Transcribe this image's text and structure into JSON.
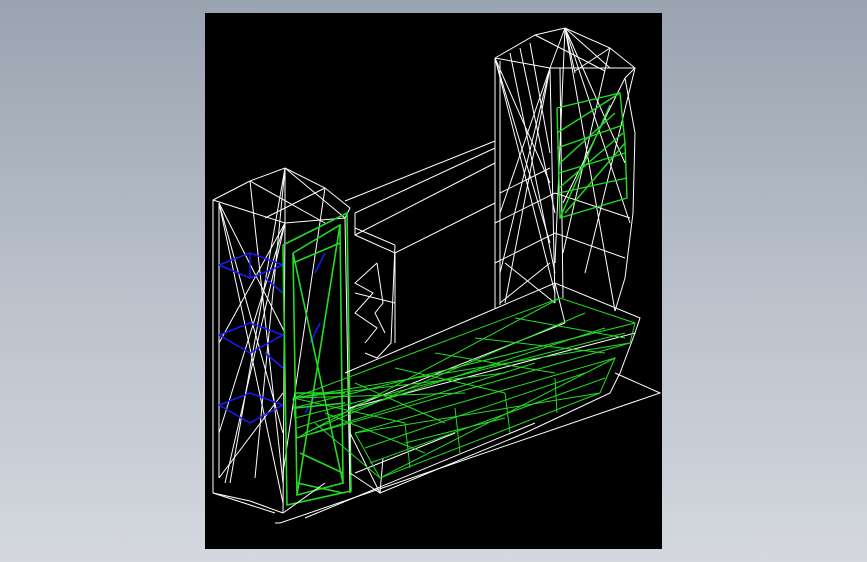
{
  "colors": {
    "background_top": "#9aa3b0",
    "background_bottom": "#d4d8de",
    "viewport_background": "#000000",
    "edges_white": "#ffffff",
    "edges_green": "#22dd22",
    "edges_blue": "#1a1aff"
  },
  "model": {
    "description_visible": false,
    "parts": [
      "left-cabinet",
      "right-cabinet",
      "back-panel",
      "desk-top",
      "drawer-unit"
    ]
  }
}
